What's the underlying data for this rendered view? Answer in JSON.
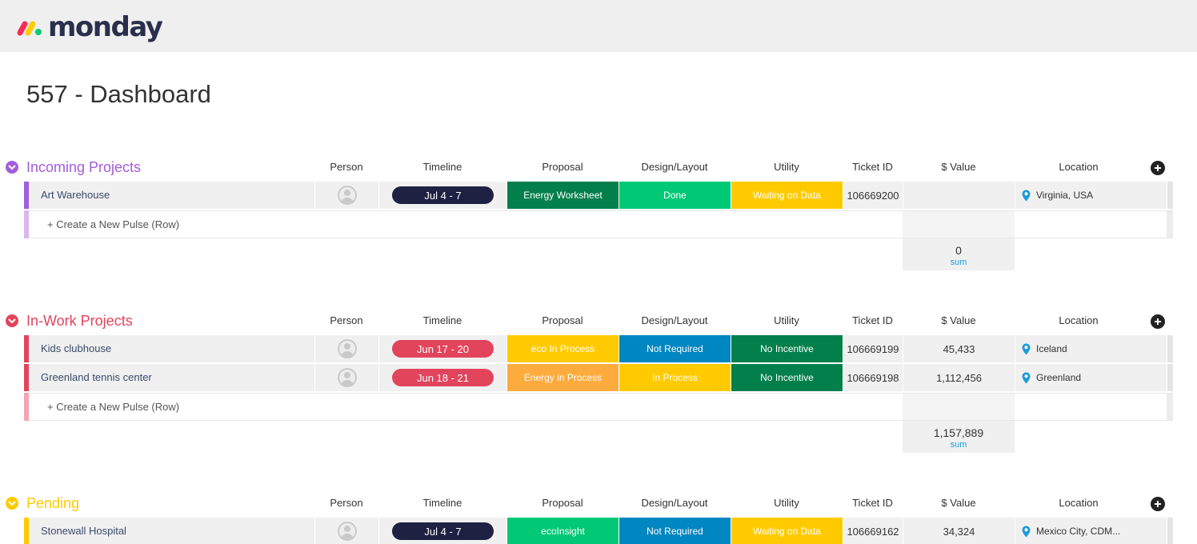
{
  "app": {
    "logo_text": "monday"
  },
  "page": {
    "title": "557 - Dashboard"
  },
  "columns": [
    "Person",
    "Timeline",
    "Proposal",
    "Design/Layout",
    "Utility",
    "Ticket ID",
    "$ Value",
    "Location"
  ],
  "create_label": "+ Create a New Pulse (Row)",
  "groups": [
    {
      "name": "Incoming Projects",
      "color": "#a25ddc",
      "rows": [
        {
          "name": "Art Warehouse",
          "timeline": "Jul 4 - 7",
          "timeline_color": "#1f2143",
          "proposal": "Energy Worksheet",
          "proposal_color": "#037f4c",
          "design": "Done",
          "design_color": "#00c875",
          "utility": "Waiting on Data",
          "utility_color": "#ffcb00",
          "ticket_id": "106669200",
          "value": "",
          "location": "Virginia, USA"
        }
      ],
      "sum_value": "0",
      "sum_label": "sum"
    },
    {
      "name": "In-Work Projects",
      "color": "#e2445c",
      "rows": [
        {
          "name": "Kids clubhouse",
          "timeline": "Jun 17 - 20",
          "timeline_color": "#e2445c",
          "proposal": "eco In Process",
          "proposal_color": "#ffcb00",
          "design": "Not Required",
          "design_color": "#0086c0",
          "utility": "No Incentive",
          "utility_color": "#037f4c",
          "ticket_id": "106669199",
          "value": "45,433",
          "location": "Iceland"
        },
        {
          "name": "Greenland tennis center",
          "timeline": "Jun 18 - 21",
          "timeline_color": "#e2445c",
          "proposal": "Energy in Process",
          "proposal_color": "#fdab3d",
          "design": "In Process",
          "design_color": "#ffcb00",
          "utility": "No Incentive",
          "utility_color": "#037f4c",
          "ticket_id": "106669198",
          "value": "1,112,456",
          "location": "Greenland"
        }
      ],
      "sum_value": "1,157,889",
      "sum_label": "sum"
    },
    {
      "name": "Pending",
      "color": "#ffcb00",
      "rows": [
        {
          "name": "Stonewall Hospital",
          "timeline": "Jul 4 - 7",
          "timeline_color": "#1f2143",
          "proposal": "ecoInsight",
          "proposal_color": "#00c875",
          "design": "Not Required",
          "design_color": "#0086c0",
          "utility": "Waiting on Data",
          "utility_color": "#ffcb00",
          "ticket_id": "106669162",
          "value": "34,324",
          "location": "Mexico City, CDM..."
        }
      ]
    }
  ]
}
